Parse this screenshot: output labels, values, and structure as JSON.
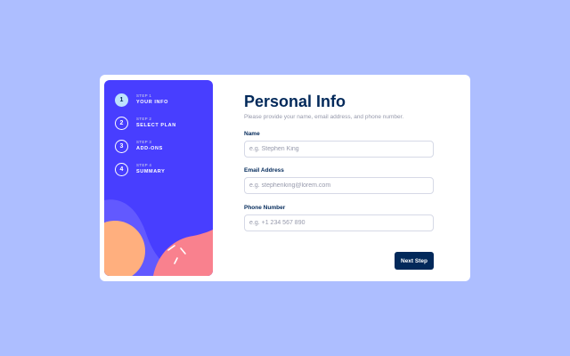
{
  "sidebar": {
    "steps": [
      {
        "number": "1",
        "small": "STEP 1",
        "title": "YOUR INFO",
        "active": true
      },
      {
        "number": "2",
        "small": "STEP 2",
        "title": "SELECT PLAN",
        "active": false
      },
      {
        "number": "3",
        "small": "STEP 3",
        "title": "ADD-ONS",
        "active": false
      },
      {
        "number": "4",
        "small": "STEP 4",
        "title": "SUMMARY",
        "active": false
      }
    ]
  },
  "main": {
    "title": "Personal Info",
    "subtitle": "Please provide your name, email address, and phone number.",
    "fields": [
      {
        "label": "Name",
        "placeholder": "e.g. Stephen King"
      },
      {
        "label": "Email Address",
        "placeholder": "e.g. stephenking@lorem.com"
      },
      {
        "label": "Phone Number",
        "placeholder": "e.g. +1 234 567 890"
      }
    ],
    "next_label": "Next Step"
  },
  "colors": {
    "page_bg": "#adbeff",
    "sidebar_bg": "#483eff",
    "active_step": "#bee2fd",
    "primary_text": "#02295a",
    "muted_text": "#9699ab",
    "border": "#d6d9e6",
    "accent_orange": "#ffaf7e",
    "accent_pink": "#f9818e",
    "accent_purple": "#6259ff"
  }
}
